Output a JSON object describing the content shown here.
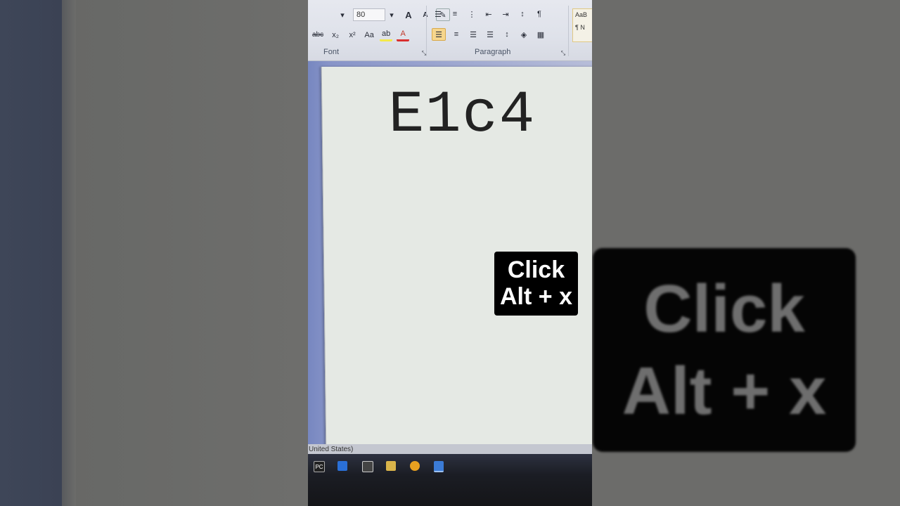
{
  "ribbon": {
    "font_size": "80",
    "font_group_label": "Font",
    "paragraph_group_label": "Paragraph",
    "styles_preview_top": "AaB",
    "styles_preview_bottom": "¶ N",
    "format_buttons": [
      "abc",
      "x₂",
      "x²",
      "Aa"
    ],
    "grow_font": "A",
    "shrink_font": "A",
    "show_marks": "¶"
  },
  "document": {
    "text": "E1c4"
  },
  "caption": {
    "line1": "Click",
    "line2": "Alt + x"
  },
  "status_bar": {
    "language": "United States)"
  },
  "taskbar": {
    "icons": [
      "pycharm-icon",
      "vscode-icon",
      "terminal-icon",
      "file-explorer-icon",
      "chrome-icon",
      "python-idle-icon"
    ],
    "pycharm_label": "PC"
  },
  "colors": {
    "highlight": "#f6d68d",
    "caption_bg": "#000000",
    "page": "#e5e9e4"
  }
}
